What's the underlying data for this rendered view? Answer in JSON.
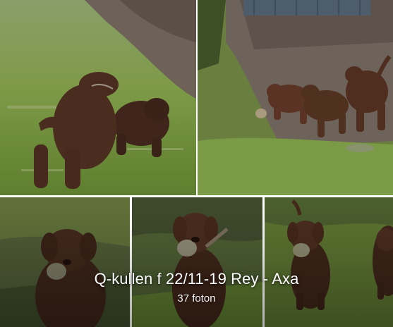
{
  "album": {
    "title": "Q-kullen f 22/11-19 Rey - Axa",
    "photo_count": "37 foton"
  },
  "photos": [
    {
      "subject": "two chocolate labrador puppies playing on grass"
    },
    {
      "subject": "three chocolate labrador puppies running on a gravel path with a ball"
    },
    {
      "subject": "chocolate labrador puppy carrying a ball"
    },
    {
      "subject": "chocolate labrador puppy carrying a toy"
    },
    {
      "subject": "chocolate labrador puppies holding a ball"
    }
  ],
  "colors": {
    "grass": "#6f8f3a",
    "gravel": "#6b5d52",
    "puppy": "#4a2c20",
    "caption_text": "#ffffff"
  }
}
